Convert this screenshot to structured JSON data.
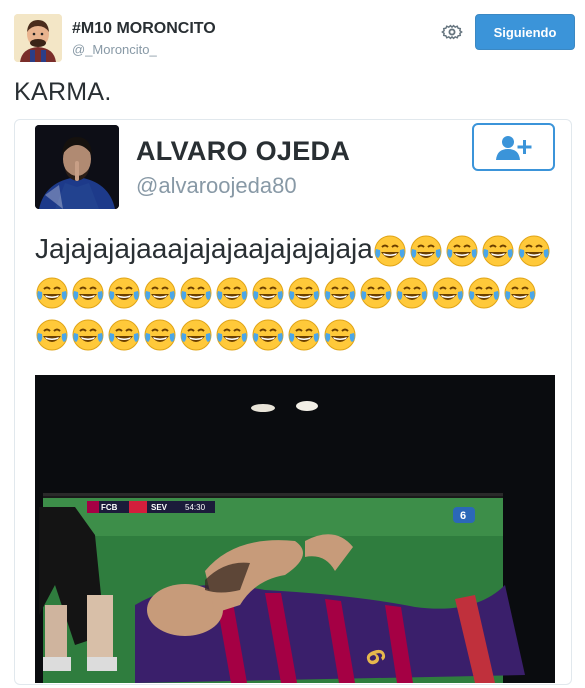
{
  "tweet": {
    "author_name": "#M10 MORONCITO",
    "author_handle": "@_Moroncito_",
    "follow_label": "Siguiendo",
    "text": "KARMA.",
    "settings_icon": "gear-icon"
  },
  "quoted": {
    "author_name": "ALVARO OJEDA",
    "author_handle": "@alvaroojeda80",
    "follow_icon": "add-user-icon",
    "text": "Jajajajajaaajajajaajajajajaja",
    "emoji_name": "face-with-tears-of-joy-icon",
    "emoji_count": 28,
    "scoreboard": {
      "home": "FCB",
      "away": "SEV",
      "time": "54:30",
      "channel": "6"
    }
  },
  "colors": {
    "accent": "#3b94d9",
    "text": "#292f33",
    "muted": "#8899a6",
    "border": "#e1e8ed",
    "emoji_face": "#ffc93a"
  }
}
